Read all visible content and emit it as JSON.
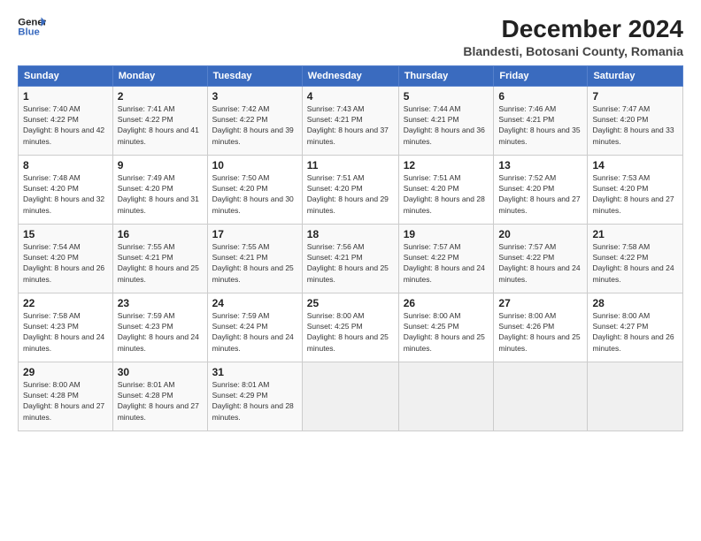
{
  "logo": {
    "line1": "General",
    "line2": "Blue"
  },
  "title": "December 2024",
  "subtitle": "Blandesti, Botosani County, Romania",
  "weekdays": [
    "Sunday",
    "Monday",
    "Tuesday",
    "Wednesday",
    "Thursday",
    "Friday",
    "Saturday"
  ],
  "weeks": [
    [
      {
        "day": "1",
        "sunrise": "7:40 AM",
        "sunset": "4:22 PM",
        "daylight": "8 hours and 42 minutes."
      },
      {
        "day": "2",
        "sunrise": "7:41 AM",
        "sunset": "4:22 PM",
        "daylight": "8 hours and 41 minutes."
      },
      {
        "day": "3",
        "sunrise": "7:42 AM",
        "sunset": "4:22 PM",
        "daylight": "8 hours and 39 minutes."
      },
      {
        "day": "4",
        "sunrise": "7:43 AM",
        "sunset": "4:21 PM",
        "daylight": "8 hours and 37 minutes."
      },
      {
        "day": "5",
        "sunrise": "7:44 AM",
        "sunset": "4:21 PM",
        "daylight": "8 hours and 36 minutes."
      },
      {
        "day": "6",
        "sunrise": "7:46 AM",
        "sunset": "4:21 PM",
        "daylight": "8 hours and 35 minutes."
      },
      {
        "day": "7",
        "sunrise": "7:47 AM",
        "sunset": "4:20 PM",
        "daylight": "8 hours and 33 minutes."
      }
    ],
    [
      {
        "day": "8",
        "sunrise": "7:48 AM",
        "sunset": "4:20 PM",
        "daylight": "8 hours and 32 minutes."
      },
      {
        "day": "9",
        "sunrise": "7:49 AM",
        "sunset": "4:20 PM",
        "daylight": "8 hours and 31 minutes."
      },
      {
        "day": "10",
        "sunrise": "7:50 AM",
        "sunset": "4:20 PM",
        "daylight": "8 hours and 30 minutes."
      },
      {
        "day": "11",
        "sunrise": "7:51 AM",
        "sunset": "4:20 PM",
        "daylight": "8 hours and 29 minutes."
      },
      {
        "day": "12",
        "sunrise": "7:51 AM",
        "sunset": "4:20 PM",
        "daylight": "8 hours and 28 minutes."
      },
      {
        "day": "13",
        "sunrise": "7:52 AM",
        "sunset": "4:20 PM",
        "daylight": "8 hours and 27 minutes."
      },
      {
        "day": "14",
        "sunrise": "7:53 AM",
        "sunset": "4:20 PM",
        "daylight": "8 hours and 27 minutes."
      }
    ],
    [
      {
        "day": "15",
        "sunrise": "7:54 AM",
        "sunset": "4:20 PM",
        "daylight": "8 hours and 26 minutes."
      },
      {
        "day": "16",
        "sunrise": "7:55 AM",
        "sunset": "4:21 PM",
        "daylight": "8 hours and 25 minutes."
      },
      {
        "day": "17",
        "sunrise": "7:55 AM",
        "sunset": "4:21 PM",
        "daylight": "8 hours and 25 minutes."
      },
      {
        "day": "18",
        "sunrise": "7:56 AM",
        "sunset": "4:21 PM",
        "daylight": "8 hours and 25 minutes."
      },
      {
        "day": "19",
        "sunrise": "7:57 AM",
        "sunset": "4:22 PM",
        "daylight": "8 hours and 24 minutes."
      },
      {
        "day": "20",
        "sunrise": "7:57 AM",
        "sunset": "4:22 PM",
        "daylight": "8 hours and 24 minutes."
      },
      {
        "day": "21",
        "sunrise": "7:58 AM",
        "sunset": "4:22 PM",
        "daylight": "8 hours and 24 minutes."
      }
    ],
    [
      {
        "day": "22",
        "sunrise": "7:58 AM",
        "sunset": "4:23 PM",
        "daylight": "8 hours and 24 minutes."
      },
      {
        "day": "23",
        "sunrise": "7:59 AM",
        "sunset": "4:23 PM",
        "daylight": "8 hours and 24 minutes."
      },
      {
        "day": "24",
        "sunrise": "7:59 AM",
        "sunset": "4:24 PM",
        "daylight": "8 hours and 24 minutes."
      },
      {
        "day": "25",
        "sunrise": "8:00 AM",
        "sunset": "4:25 PM",
        "daylight": "8 hours and 25 minutes."
      },
      {
        "day": "26",
        "sunrise": "8:00 AM",
        "sunset": "4:25 PM",
        "daylight": "8 hours and 25 minutes."
      },
      {
        "day": "27",
        "sunrise": "8:00 AM",
        "sunset": "4:26 PM",
        "daylight": "8 hours and 25 minutes."
      },
      {
        "day": "28",
        "sunrise": "8:00 AM",
        "sunset": "4:27 PM",
        "daylight": "8 hours and 26 minutes."
      }
    ],
    [
      {
        "day": "29",
        "sunrise": "8:00 AM",
        "sunset": "4:28 PM",
        "daylight": "8 hours and 27 minutes."
      },
      {
        "day": "30",
        "sunrise": "8:01 AM",
        "sunset": "4:28 PM",
        "daylight": "8 hours and 27 minutes."
      },
      {
        "day": "31",
        "sunrise": "8:01 AM",
        "sunset": "4:29 PM",
        "daylight": "8 hours and 28 minutes."
      },
      null,
      null,
      null,
      null
    ]
  ],
  "labels": {
    "sunrise": "Sunrise:",
    "sunset": "Sunset:",
    "daylight": "Daylight:"
  }
}
